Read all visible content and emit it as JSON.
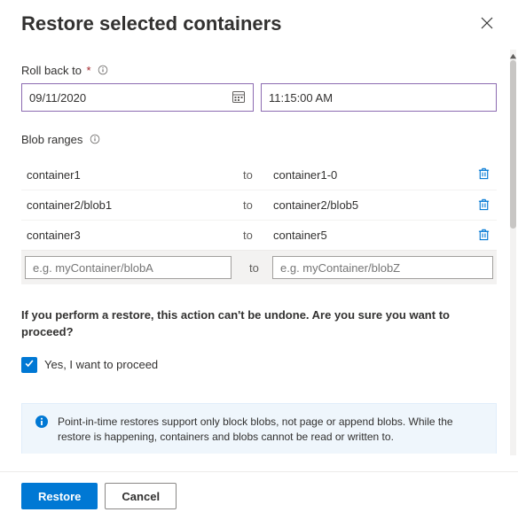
{
  "header": {
    "title": "Restore selected containers"
  },
  "rollback": {
    "label": "Roll back to",
    "date": "09/11/2020",
    "time": "11:15:00 AM"
  },
  "ranges": {
    "label": "Blob ranges",
    "to_word": "to",
    "rows": [
      {
        "from": "container1",
        "target": "container1-0"
      },
      {
        "from": "container2/blob1",
        "target": "container2/blob5"
      },
      {
        "from": "container3",
        "target": "container5"
      }
    ],
    "add_placeholder_from": "e.g. myContainer/blobA",
    "add_placeholder_target": "e.g. myContainer/blobZ"
  },
  "warning": "If you perform a restore, this action can't be undone. Are you sure you want to proceed?",
  "confirm": {
    "checked": true,
    "label": "Yes, I want to proceed"
  },
  "info": "Point-in-time restores support only block blobs, not page or append blobs. While the restore is happening, containers and blobs cannot be read or written to.",
  "buttons": {
    "primary": "Restore",
    "secondary": "Cancel"
  }
}
